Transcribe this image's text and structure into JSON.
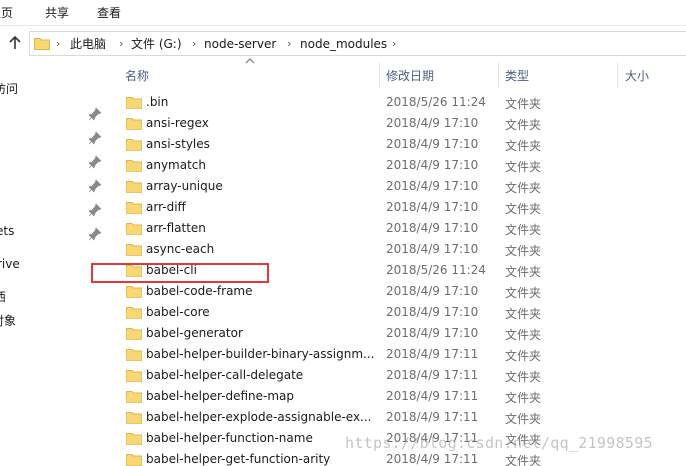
{
  "ribbon": {
    "tabs": [
      "主页",
      "共享",
      "查看"
    ]
  },
  "address": {
    "crumbs": [
      "此电脑",
      "文件 (G:)",
      "node-server",
      "node_modules"
    ]
  },
  "nav": {
    "items": [
      "访问",
      "ets",
      "rive",
      "西",
      "对象"
    ]
  },
  "columns": {
    "name": "名称",
    "date": "修改日期",
    "type": "类型",
    "size": "大小"
  },
  "rows": [
    {
      "name": ".bin",
      "date": "2018/5/26 11:24",
      "type": "文件夹"
    },
    {
      "name": "ansi-regex",
      "date": "2018/4/9 17:10",
      "type": "文件夹"
    },
    {
      "name": "ansi-styles",
      "date": "2018/4/9 17:10",
      "type": "文件夹"
    },
    {
      "name": "anymatch",
      "date": "2018/4/9 17:10",
      "type": "文件夹"
    },
    {
      "name": "array-unique",
      "date": "2018/4/9 17:10",
      "type": "文件夹"
    },
    {
      "name": "arr-diff",
      "date": "2018/4/9 17:10",
      "type": "文件夹"
    },
    {
      "name": "arr-flatten",
      "date": "2018/4/9 17:10",
      "type": "文件夹"
    },
    {
      "name": "async-each",
      "date": "2018/4/9 17:10",
      "type": "文件夹"
    },
    {
      "name": "babel-cli",
      "date": "2018/5/26 11:24",
      "type": "文件夹"
    },
    {
      "name": "babel-code-frame",
      "date": "2018/4/9 17:10",
      "type": "文件夹"
    },
    {
      "name": "babel-core",
      "date": "2018/4/9 17:10",
      "type": "文件夹"
    },
    {
      "name": "babel-generator",
      "date": "2018/4/9 17:10",
      "type": "文件夹"
    },
    {
      "name": "babel-helper-builder-binary-assignm...",
      "date": "2018/4/9 17:11",
      "type": "文件夹"
    },
    {
      "name": "babel-helper-call-delegate",
      "date": "2018/4/9 17:11",
      "type": "文件夹"
    },
    {
      "name": "babel-helper-define-map",
      "date": "2018/4/9 17:11",
      "type": "文件夹"
    },
    {
      "name": "babel-helper-explode-assignable-ex...",
      "date": "2018/4/9 17:11",
      "type": "文件夹"
    },
    {
      "name": "babel-helper-function-name",
      "date": "2018/4/9 17:11",
      "type": "文件夹"
    },
    {
      "name": "babel-helper-get-function-arity",
      "date": "2018/4/9 17:11",
      "type": "文件夹"
    }
  ],
  "watermark": "https://blog.csdn.net/qq_21998595",
  "colors": {
    "folder": "#f8d775",
    "folder_dark": "#e0b64a",
    "highlight": "#e2383a",
    "header_text": "#4d6082"
  },
  "icons": [
    "up-arrow-icon",
    "folder-icon",
    "pin-icon",
    "sort-caret-icon"
  ]
}
